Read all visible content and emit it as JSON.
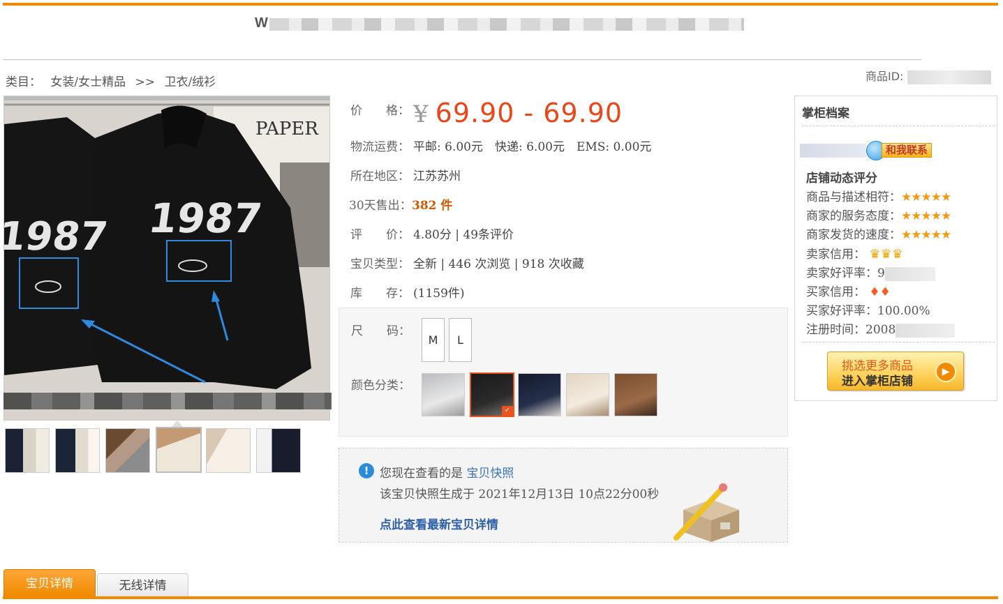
{
  "header": {
    "title_visible": "W"
  },
  "breadcrumb": {
    "prefix": "类目：",
    "cat1": "女装/女士精品",
    "sep": ">>",
    "cat2": "卫衣/绒衫"
  },
  "item_id_label": "商品ID:",
  "product": {
    "price_label": "价　　格：",
    "currency": "¥",
    "price_range": "69.90 - 69.90",
    "shipping_label": "物流运费：",
    "shipping_value": "平邮: 6.00元　快递: 6.00元　EMS: 0.00元",
    "location_label": "所在地区：",
    "location_value": "江苏苏州",
    "sold_label": "30天售出：",
    "sold_value": "382 件",
    "review_label": "评　　价：",
    "review_value": "4.80分 | 49条评价",
    "type_label": "宝贝类型：",
    "type_value": "全新 | 446 次浏览 | 918 次收藏",
    "stock_label": "库　　存：",
    "stock_value": "(1159件)"
  },
  "sku": {
    "size_label": "尺　　码：",
    "sizes": [
      "M",
      "L"
    ],
    "color_label": "颜色分类："
  },
  "snapshot": {
    "line1_prefix": "您现在查看的是",
    "line1_link": "宝贝快照",
    "line2": "该宝贝快照生成于 2021年12月13日 10点22分00秒",
    "latest_link": "点此查看最新宝贝详情"
  },
  "seller": {
    "title": "掌柜档案",
    "contact": "和我联系",
    "rating_title": "店铺动态评分",
    "desc_match": "商品与描述相符：",
    "service": "商家的服务态度：",
    "delivery": "商家发货的速度：",
    "stars": "★★★★★",
    "seller_credit": "卖家信用：",
    "seller_good_rate": "卖家好评率：",
    "seller_good_rate_partial": "9",
    "buyer_credit": "买家信用：",
    "buyer_good_rate": "买家好评率：100.00%",
    "register": "注册时间：",
    "register_partial": "2008",
    "shop_line1": "挑选更多商品",
    "shop_line2": "进入掌柜店铺"
  },
  "tabs": {
    "detail": "宝贝详情",
    "wireless": "无线详情"
  },
  "colors": {
    "accent": "#f08a00",
    "price": "#e9461a",
    "link": "#3b74b8"
  }
}
